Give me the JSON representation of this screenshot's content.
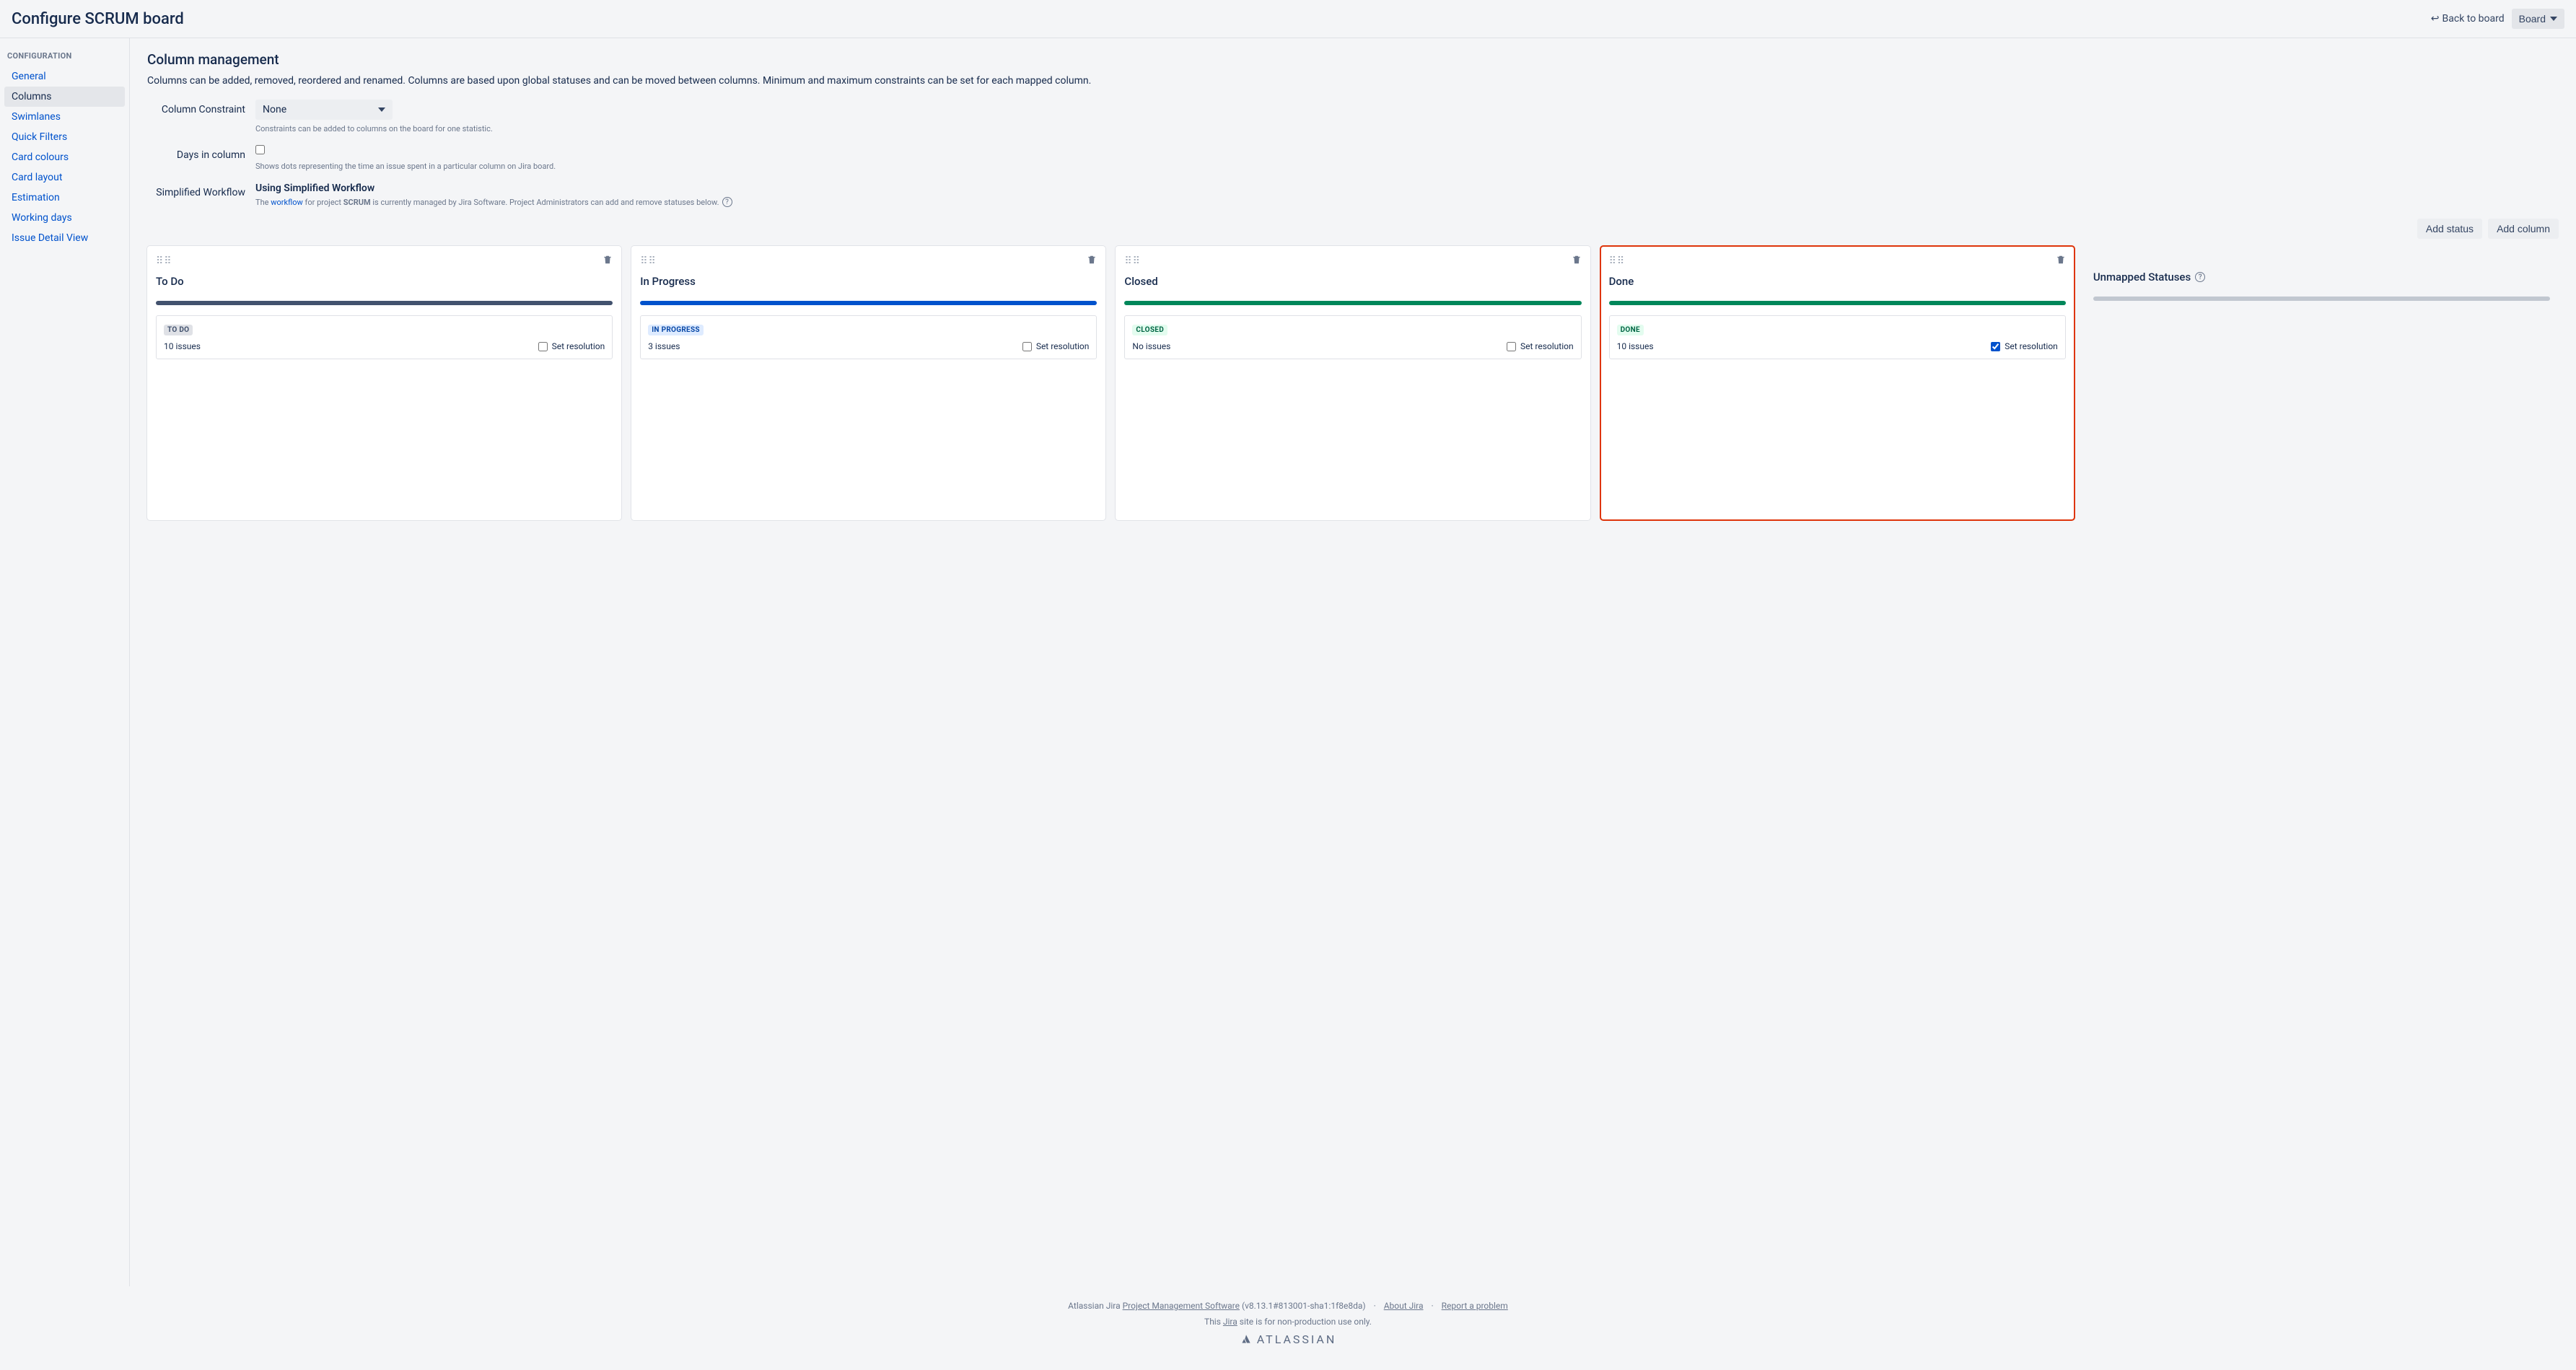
{
  "header": {
    "title": "Configure SCRUM board",
    "back_label": "Back to board",
    "board_button": "Board"
  },
  "sidebar": {
    "heading": "CONFIGURATION",
    "items": [
      "General",
      "Columns",
      "Swimlanes",
      "Quick Filters",
      "Card colours",
      "Card layout",
      "Estimation",
      "Working days",
      "Issue Detail View"
    ],
    "active_index": 1
  },
  "page": {
    "title": "Column management",
    "description": "Columns can be added, removed, reordered and renamed. Columns are based upon global statuses and can be moved between columns. Minimum and maximum constraints can be set for each mapped column."
  },
  "settings": {
    "column_constraint_label": "Column Constraint",
    "column_constraint_value": "None",
    "column_constraint_hint": "Constraints can be added to columns on the board for one statistic.",
    "days_in_column_label": "Days in column",
    "days_in_column_checked": false,
    "days_in_column_hint": "Shows dots representing the time an issue spent in a particular column on Jira board.",
    "workflow_label": "Simplified Workflow",
    "workflow_title": "Using Simplified Workflow",
    "workflow_desc_pre": "The ",
    "workflow_link": "workflow",
    "workflow_desc_mid": " for project ",
    "workflow_project": "SCRUM",
    "workflow_desc_post": " is currently managed by Jira Software. Project Administrators can add and remove statuses below."
  },
  "actions": {
    "add_status": "Add status",
    "add_column": "Add column"
  },
  "columns": [
    {
      "name": "To Do",
      "bar": "bar-gray",
      "highlight": false,
      "status": {
        "label": "TO DO",
        "loz": "loz-gray",
        "issues": "10 issues",
        "set_resolution": "Set resolution",
        "checked": false
      }
    },
    {
      "name": "In Progress",
      "bar": "bar-blue",
      "highlight": false,
      "status": {
        "label": "IN PROGRESS",
        "loz": "loz-blue",
        "issues": "3 issues",
        "set_resolution": "Set resolution",
        "checked": false
      }
    },
    {
      "name": "Closed",
      "bar": "bar-green",
      "highlight": false,
      "status": {
        "label": "CLOSED",
        "loz": "loz-green",
        "issues": "No issues",
        "set_resolution": "Set resolution",
        "checked": false
      }
    },
    {
      "name": "Done",
      "bar": "bar-green",
      "highlight": true,
      "status": {
        "label": "DONE",
        "loz": "loz-green",
        "issues": "10 issues",
        "set_resolution": "Set resolution",
        "checked": true
      }
    }
  ],
  "unmapped": {
    "title": "Unmapped Statuses"
  },
  "footer": {
    "line1_pre": "Atlassian Jira ",
    "line1_link": "Project Management Software",
    "line1_post": " (v8.13.1#813001-sha1:1f8e8da)",
    "about": "About Jira",
    "report": "Report a problem",
    "line2_pre": "This ",
    "line2_link": "Jira",
    "line2_post": " site is for non-production use only.",
    "brand": "ATLASSIAN"
  }
}
